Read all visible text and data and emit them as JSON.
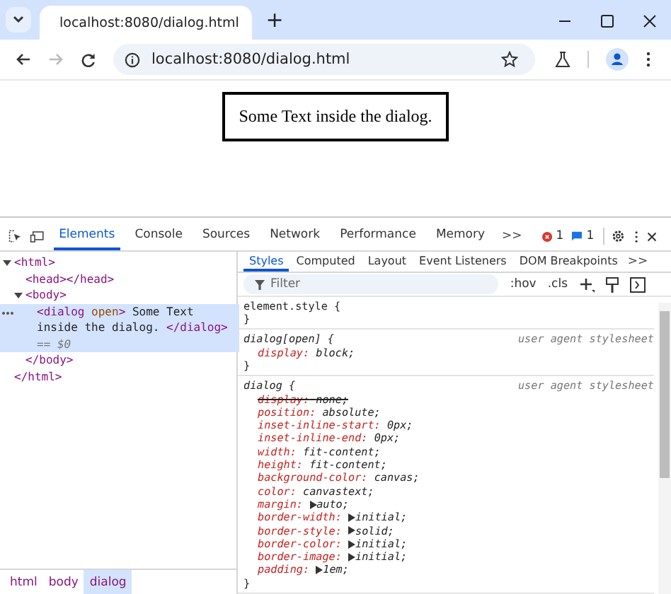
{
  "browser": {
    "tabs": [
      {
        "title": "localhost:8080/dialog.html",
        "selected": true
      }
    ],
    "new_tab": "+",
    "address": "localhost:8080/dialog.html",
    "back_disabled": false,
    "forward_disabled": true
  },
  "page": {
    "dialog_text": "Some Text inside the dialog."
  },
  "devtools": {
    "panel_tabs": [
      {
        "label": "Elements",
        "selected": true
      },
      {
        "label": "Console",
        "selected": false
      },
      {
        "label": "Sources",
        "selected": false
      },
      {
        "label": "Network",
        "selected": false
      },
      {
        "label": "Performance",
        "selected": false
      },
      {
        "label": "Memory",
        "selected": false
      }
    ],
    "panel_overflow": ">>",
    "error_count": "1",
    "message_count": "1",
    "dom_tree": [
      {
        "parts": [
          {
            "kind": "tag",
            "text": "<html>"
          }
        ],
        "expanded": true,
        "selected": false,
        "close": "</html>",
        "children": [
          {
            "parts": [
              {
                "kind": "tag",
                "text": "<head></head>"
              }
            ],
            "selected": false
          },
          {
            "parts": [
              {
                "kind": "tag",
                "text": "<body>"
              }
            ],
            "expanded": true,
            "selected": false,
            "close": "</body>",
            "children": [
              {
                "parts": [
                  {
                    "kind": "tag",
                    "text": "<dialog"
                  },
                  {
                    "kind": "attr",
                    "text": " open"
                  },
                  {
                    "kind": "tag",
                    "text": ">"
                  },
                  {
                    "kind": "text",
                    "text": " Some Text inside the dialog. "
                  },
                  {
                    "kind": "tag",
                    "text": "</dialog>"
                  },
                  {
                    "kind": "ref",
                    "text": " == $0"
                  }
                ],
                "selected": true
              }
            ]
          }
        ]
      }
    ],
    "styles_tabs": [
      {
        "label": "Styles",
        "selected": true
      },
      {
        "label": "Computed",
        "selected": false
      },
      {
        "label": "Layout",
        "selected": false
      },
      {
        "label": "Event Listeners",
        "selected": false
      },
      {
        "label": "DOM Breakpoints",
        "selected": false
      }
    ],
    "styles_overflow": ">>",
    "filter": {
      "placeholder": "Filter"
    },
    "hov": ":hov",
    "cls": ".cls",
    "rules": [
      {
        "selector": "element.style {",
        "italic": false,
        "close": "}"
      },
      {
        "selector": "dialog[open] {",
        "italic": true,
        "source": "user agent stylesheet",
        "declarations": [
          {
            "property": "display:",
            "value": "block;",
            "struck": false,
            "expandable": false
          }
        ],
        "close": "}"
      },
      {
        "selector": "dialog {",
        "italic": true,
        "source": "user agent stylesheet",
        "declarations": [
          {
            "property": "display:",
            "value": "none;",
            "struck": true,
            "expandable": false
          },
          {
            "property": "position:",
            "value": "absolute;",
            "struck": false,
            "expandable": false
          },
          {
            "property": "inset-inline-start:",
            "value": "0px;",
            "struck": false,
            "expandable": false
          },
          {
            "property": "inset-inline-end:",
            "value": "0px;",
            "struck": false,
            "expandable": false
          },
          {
            "property": "width:",
            "value": "fit-content;",
            "struck": false,
            "expandable": false
          },
          {
            "property": "height:",
            "value": "fit-content;",
            "struck": false,
            "expandable": false
          },
          {
            "property": "background-color:",
            "value": "canvas;",
            "struck": false,
            "expandable": false
          },
          {
            "property": "color:",
            "value": "canvastext;",
            "struck": false,
            "expandable": false
          },
          {
            "property": "margin:",
            "value": "auto;",
            "struck": false,
            "expandable": true
          },
          {
            "property": "border-width:",
            "value": "initial;",
            "struck": false,
            "expandable": true
          },
          {
            "property": "border-style:",
            "value": "solid;",
            "struck": false,
            "expandable": true
          },
          {
            "property": "border-color:",
            "value": "initial;",
            "struck": false,
            "expandable": true
          },
          {
            "property": "border-image:",
            "value": "initial;",
            "struck": false,
            "expandable": true
          },
          {
            "property": "padding:",
            "value": "1em;",
            "struck": false,
            "expandable": true
          }
        ],
        "close": "}"
      }
    ],
    "breadcrumbs": [
      {
        "label": "html",
        "selected": false
      },
      {
        "label": "body",
        "selected": false
      },
      {
        "label": "dialog",
        "selected": true
      }
    ]
  }
}
